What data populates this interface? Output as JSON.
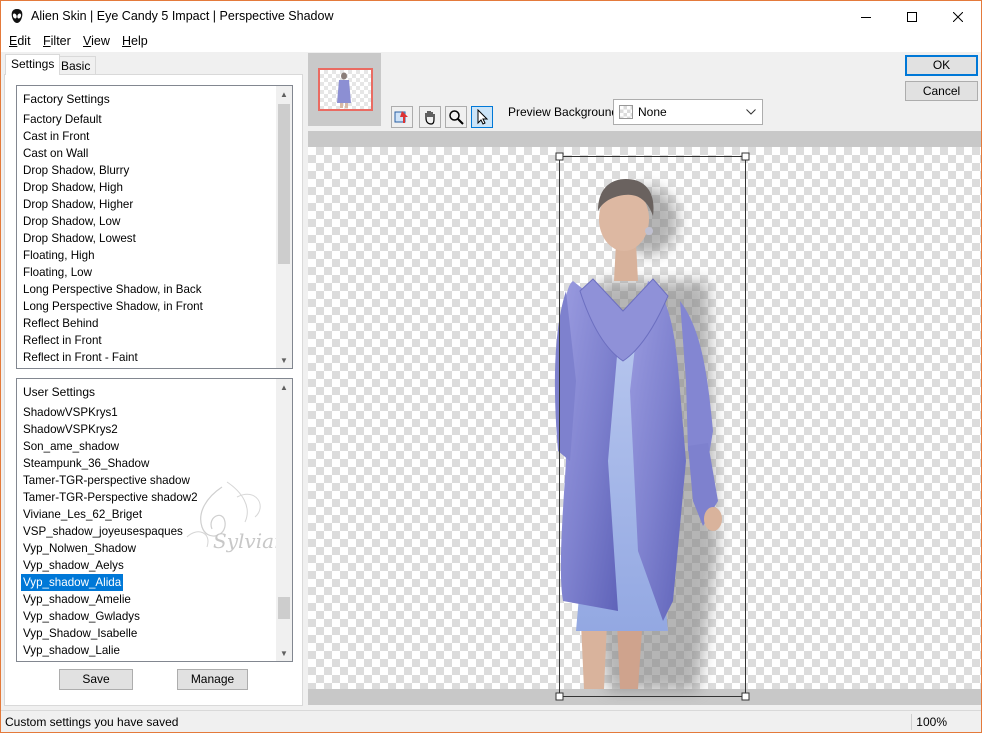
{
  "window": {
    "title": "Alien Skin | Eye Candy 5 Impact | Perspective Shadow",
    "accent_border": "#e47a3b"
  },
  "menu": {
    "items": [
      {
        "label": "Edit",
        "hotkey": "E",
        "rest": "dit"
      },
      {
        "label": "Filter",
        "hotkey": "F",
        "rest": "ilter"
      },
      {
        "label": "View",
        "hotkey": "V",
        "rest": "iew"
      },
      {
        "label": "Help",
        "hotkey": "H",
        "rest": "elp"
      }
    ]
  },
  "tabs": {
    "settings": "Settings",
    "basic": "Basic"
  },
  "factory": {
    "header": "Factory Settings",
    "items": [
      "Factory Default",
      "Cast in Front",
      "Cast on Wall",
      "Drop Shadow, Blurry",
      "Drop Shadow, High",
      "Drop Shadow, Higher",
      "Drop Shadow, Low",
      "Drop Shadow, Lowest",
      "Floating, High",
      "Floating, Low",
      "Long Perspective Shadow, in Back",
      "Long Perspective Shadow, in Front",
      "Reflect Behind",
      "Reflect in Front",
      "Reflect in Front - Faint"
    ]
  },
  "user": {
    "header": "User Settings",
    "items": [
      "ShadowVSPKrys1",
      "ShadowVSPKrys2",
      "Son_ame_shadow",
      "Steampunk_36_Shadow",
      "Tamer-TGR-perspective shadow",
      "Tamer-TGR-Perspective shadow2",
      "Viviane_Les_62_Briget",
      "VSP_shadow_joyeusespaques",
      "Vyp_Nolwen_Shadow",
      "Vyp_shadow_Aelys",
      "Vyp_shadow_Alida",
      "Vyp_shadow_Amelie",
      "Vyp_shadow_Gwladys",
      "Vyp_Shadow_Isabelle",
      "Vyp_shadow_Lalie"
    ],
    "selected": "Vyp_shadow_Alida",
    "watermark": "Sylviane"
  },
  "buttons": {
    "save": "Save",
    "manage": "Manage",
    "ok": "OK",
    "cancel": "Cancel"
  },
  "preview": {
    "background_label": "Preview Background:",
    "background_value": "None",
    "tools": [
      "navigate-icon",
      "hand-icon",
      "zoom-icon",
      "pointer-icon"
    ]
  },
  "status": {
    "text": "Custom settings you have saved",
    "zoom": "100%"
  }
}
